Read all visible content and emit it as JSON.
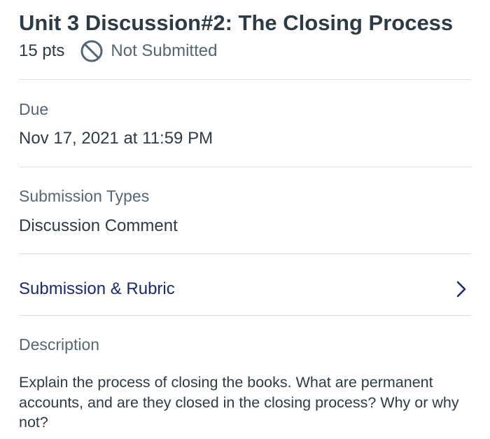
{
  "assignment": {
    "title": "Unit 3 Discussion#2: The Closing Process",
    "points": "15 pts",
    "status": "Not Submitted",
    "status_icon": "not-submitted-icon"
  },
  "due": {
    "label": "Due",
    "value": "Nov 17, 2021 at 11:59 PM"
  },
  "submission_types": {
    "label": "Submission Types",
    "value": "Discussion Comment"
  },
  "submission_rubric": {
    "label": "Submission & Rubric",
    "icon": "chevron-right-icon"
  },
  "description": {
    "label": "Description",
    "text": "Explain the process of closing the books. What are permanent accounts, and are they closed in the closing process? Why or why not?"
  },
  "colors": {
    "text_primary": "#2d3b45",
    "text_secondary": "#566673",
    "link": "#1a2b6d",
    "divider": "#dde2e6"
  }
}
